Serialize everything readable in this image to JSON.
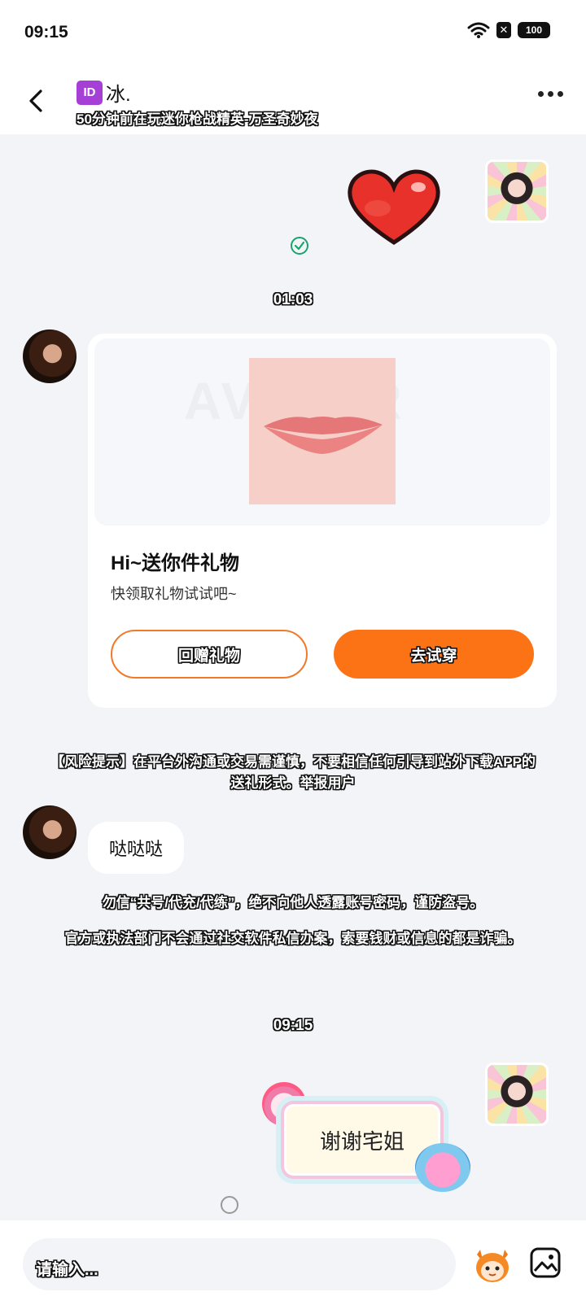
{
  "status_bar": {
    "time": "09:15",
    "battery": "100"
  },
  "header": {
    "title": "冰.",
    "subtitle": "50分钟前在玩迷你枪战精英-万圣奇妙夜"
  },
  "messages": {
    "timestamp_1": "01:03",
    "gift_card": {
      "watermark": "AVATAR",
      "title": "Hi~送你件礼物",
      "description": "快领取礼物试试吧~",
      "return_gift_label": "回赠礼物",
      "try_on_label": "去试穿"
    },
    "risk_notice": "【风险提示】在平台外沟通或交易需谨慎，不要相信任何引导到站外下载APP的送礼形式。举报用户",
    "text_message": "哒哒哒",
    "security_notice_1": "勿信“共号/代充/代练”，绝不向他人透露账号密码，谨防盗号。",
    "security_notice_2": "官方或执法部门不会通过社交软件私信办案，索要钱财或信息的都是诈骗。",
    "timestamp_2": "09:15",
    "sticker_message": "谢谢宅姐"
  },
  "input_bar": {
    "placeholder": "请输入..."
  },
  "colors": {
    "accent": "#fb7315",
    "background": "#f3f4f8",
    "check": "#1aa36b"
  }
}
